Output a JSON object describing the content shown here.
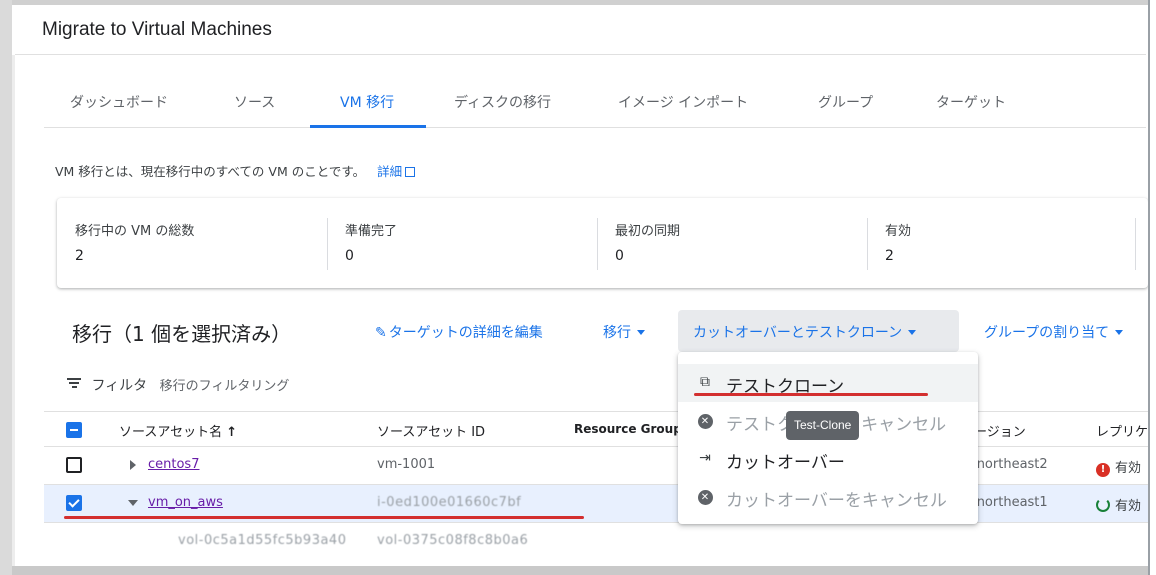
{
  "header": {
    "title": "Migrate to Virtual Machines"
  },
  "tabs": [
    {
      "label": "ダッシュボード",
      "active": false
    },
    {
      "label": "ソース",
      "active": false
    },
    {
      "label": "VM 移行",
      "active": true
    },
    {
      "label": "ディスクの移行",
      "active": false
    },
    {
      "label": "イメージ インポート",
      "active": false
    },
    {
      "label": "グループ",
      "active": false
    },
    {
      "label": "ターゲット",
      "active": false
    }
  ],
  "description": {
    "text": "VM 移行とは、現在移行中のすべての VM のことです。",
    "link": "詳細"
  },
  "stats": [
    {
      "label": "移行中の VM の総数",
      "value": "2"
    },
    {
      "label": "準備完了",
      "value": "0"
    },
    {
      "label": "最初の同期",
      "value": "0"
    },
    {
      "label": "有効",
      "value": "2"
    }
  ],
  "toolbar": {
    "title": "移行（1 個を選択済み）",
    "edit_target": "ターゲットの詳細を編集",
    "migrate": "移行",
    "cutover_clone": "カットオーバーとテストクローン",
    "assign_group": "グループの割り当て"
  },
  "filter": {
    "label": "フィルタ",
    "placeholder": "移行のフィルタリング"
  },
  "table": {
    "columns": [
      "ソースアセット名",
      "ソースアセット ID",
      "Resource Group",
      "ージョン",
      "レプリケ"
    ],
    "rows": [
      {
        "name": "centos7",
        "id": "vm-1001",
        "region": "-northeast2",
        "status": "有効",
        "status_type": "error",
        "selected": false
      },
      {
        "name": "vm_on_aws",
        "id": "i-0ed100e01660c7bf",
        "region": "-northeast1",
        "status": "有効",
        "status_type": "ok",
        "selected": true
      }
    ],
    "sub_row": {
      "name": "vol-0c5a1d55fc5b93a40",
      "id": "vol-0375c08f8c8b0a6"
    }
  },
  "menu": {
    "items": [
      {
        "label": "テストクローン",
        "icon": "test-clone-icon",
        "disabled": false
      },
      {
        "label": "テストクローンをキャンセル",
        "icon": "cancel-circle-icon",
        "disabled": true
      },
      {
        "label": "カットオーバー",
        "icon": "cutover-icon",
        "disabled": false
      },
      {
        "label": "カットオーバーをキャンセル",
        "icon": "cancel-circle-icon",
        "disabled": true
      }
    ]
  },
  "tooltip": "Test-Clone",
  "colors": {
    "accent": "#1a73e8",
    "highlight": "#d32f2f",
    "error": "#d93025",
    "success": "#188038"
  }
}
